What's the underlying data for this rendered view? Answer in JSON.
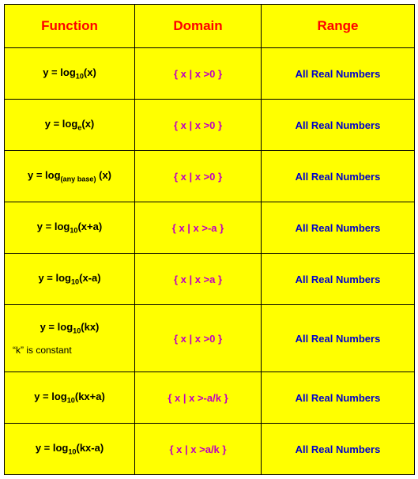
{
  "headers": {
    "function": "Function",
    "domain": "Domain",
    "range": "Range"
  },
  "rows": [
    {
      "func_html": "y = log<sub>10</sub>(x)",
      "domain": "{ x  |  x >0 }",
      "range": "All Real Numbers",
      "note": ""
    },
    {
      "func_html": "y = log<sub>e</sub>(x)",
      "domain": "{ x  |  x >0 }",
      "range": "All Real Numbers",
      "note": ""
    },
    {
      "func_html": "y = log<sub>(any base)</sub> (x)",
      "domain": "{ x  |  x >0 }",
      "range": "All Real Numbers",
      "note": ""
    },
    {
      "func_html": "y = log<sub>10</sub>(x+a)",
      "domain": "{ x  |  x >-a }",
      "range": "All Real Numbers",
      "note": ""
    },
    {
      "func_html": "y = log<sub>10</sub>(x-a)",
      "domain": "{ x  |  x >a }",
      "range": "All Real Numbers",
      "note": ""
    },
    {
      "func_html": "y = log<sub>10</sub>(kx)",
      "domain": "{ x  |  x >0 }",
      "range": "All Real Numbers",
      "note": "“k” is constant"
    },
    {
      "func_html": "y = log<sub>10</sub>(kx+a)",
      "domain": "{ x  |  x >-a/k }",
      "range": "All Real Numbers",
      "note": ""
    },
    {
      "func_html": "y = log<sub>10</sub>(kx-a)",
      "domain": "{ x  |  x >a/k }",
      "range": "All Real Numbers",
      "note": ""
    }
  ],
  "chart_data": {
    "type": "table",
    "title": "Domain and Range of Logarithmic Functions",
    "columns": [
      "Function",
      "Domain",
      "Range"
    ],
    "rows": [
      [
        "y = log_10(x)",
        "{ x | x > 0 }",
        "All Real Numbers"
      ],
      [
        "y = log_e(x)",
        "{ x | x > 0 }",
        "All Real Numbers"
      ],
      [
        "y = log_(any base)(x)",
        "{ x | x > 0 }",
        "All Real Numbers"
      ],
      [
        "y = log_10(x+a)",
        "{ x | x > -a }",
        "All Real Numbers"
      ],
      [
        "y = log_10(x-a)",
        "{ x | x > a }",
        "All Real Numbers"
      ],
      [
        "y = log_10(kx), k is constant",
        "{ x | x > 0 }",
        "All Real Numbers"
      ],
      [
        "y = log_10(kx+a)",
        "{ x | x > -a/k }",
        "All Real Numbers"
      ],
      [
        "y = log_10(kx-a)",
        "{ x | x > a/k }",
        "All Real Numbers"
      ]
    ]
  }
}
